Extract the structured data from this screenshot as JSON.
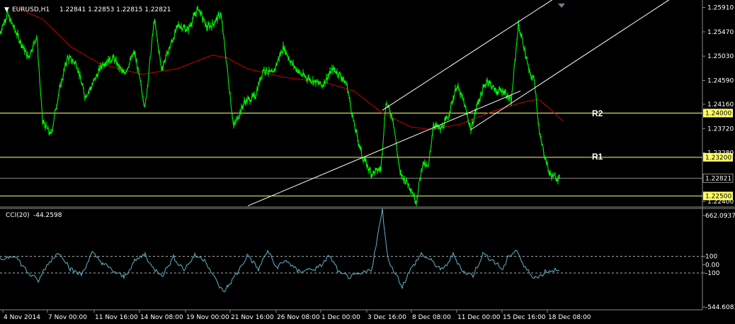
{
  "header": {
    "menu_glyph": "▼",
    "symbol": "EURUSD,H1",
    "ohlc": "1.22841 1.22853 1.22815 1.22821"
  },
  "indicator": {
    "name": "CCI(20)",
    "value": "-44.2598"
  },
  "price_axis": {
    "labels": [
      "1.25910",
      "1.25470",
      "1.25030",
      "1.24590",
      "1.24160",
      "1.23720",
      "1.23280",
      "1.22400"
    ]
  },
  "cci_axis": {
    "labels": [
      "662.0937",
      "100",
      "0.00",
      "-100",
      "-544.6083"
    ]
  },
  "lines": {
    "r2": {
      "label": "R2",
      "price": "1.24000",
      "color": "#ffff66"
    },
    "r1": {
      "label": "R1",
      "price": "1.23200",
      "color": "#ffff66"
    },
    "support": {
      "price": "1.22500",
      "color": "#ffff66"
    },
    "current": {
      "price": "1.22821",
      "color": "#8a8a8a"
    }
  },
  "time_axis": {
    "labels": [
      "4 Nov 2014",
      "7 Nov 00:00",
      "11 Nov 16:00",
      "14 Nov 08:00",
      "19 Nov 00:00",
      "21 Nov 16:00",
      "26 Nov 08:00",
      "1 Dec 00:00",
      "3 Dec 16:00",
      "8 Dec 08:00",
      "11 Dec 00:00",
      "15 Dec 16:00",
      "18 Dec 08:00"
    ]
  },
  "colors": {
    "background": "#000000",
    "price_series": "#00ff00",
    "moving_average": "#cc0000",
    "channel": "#ffffff",
    "cci": "#5fb4c8",
    "level_line": "#ffff66"
  },
  "chart_data": {
    "type": "line",
    "price_range": [
      1.223,
      1.2602
    ],
    "cci_range": [
      -544.6083,
      662.0937
    ],
    "cci_levels": [
      100,
      0,
      -100
    ],
    "price_anchors": [
      [
        0,
        1.2545
      ],
      [
        10,
        1.258
      ],
      [
        25,
        1.254
      ],
      [
        40,
        1.25
      ],
      [
        52,
        1.254
      ],
      [
        60,
        1.2385
      ],
      [
        72,
        1.236
      ],
      [
        82,
        1.243
      ],
      [
        95,
        1.25
      ],
      [
        108,
        1.249
      ],
      [
        120,
        1.243
      ],
      [
        130,
        1.245
      ],
      [
        145,
        1.249
      ],
      [
        160,
        1.25
      ],
      [
        175,
        1.247
      ],
      [
        190,
        1.251
      ],
      [
        205,
        1.241
      ],
      [
        218,
        1.257
      ],
      [
        228,
        1.248
      ],
      [
        240,
        1.252
      ],
      [
        252,
        1.256
      ],
      [
        265,
        1.255
      ],
      [
        280,
        1.259
      ],
      [
        292,
        1.2555
      ],
      [
        300,
        1.256
      ],
      [
        312,
        1.258
      ],
      [
        320,
        1.249
      ],
      [
        330,
        1.2375
      ],
      [
        345,
        1.242
      ],
      [
        360,
        1.243
      ],
      [
        372,
        1.248
      ],
      [
        385,
        1.247
      ],
      [
        400,
        1.252
      ],
      [
        412,
        1.249
      ],
      [
        425,
        1.247
      ],
      [
        440,
        1.246
      ],
      [
        455,
        1.245
      ],
      [
        470,
        1.248
      ],
      [
        480,
        1.247
      ],
      [
        490,
        1.245
      ],
      [
        500,
        1.238
      ],
      [
        512,
        1.232
      ],
      [
        525,
        1.229
      ],
      [
        538,
        1.23
      ],
      [
        545,
        1.242
      ],
      [
        555,
        1.239
      ],
      [
        565,
        1.229
      ],
      [
        578,
        1.227
      ],
      [
        588,
        1.224
      ],
      [
        597,
        1.231
      ],
      [
        605,
        1.23
      ],
      [
        612,
        1.238
      ],
      [
        622,
        1.237
      ],
      [
        632,
        1.239
      ],
      [
        645,
        1.245
      ],
      [
        655,
        1.242
      ],
      [
        665,
        1.237
      ],
      [
        675,
        1.242
      ],
      [
        688,
        1.246
      ],
      [
        700,
        1.244
      ],
      [
        712,
        1.244
      ],
      [
        722,
        1.242
      ],
      [
        732,
        1.256
      ],
      [
        740,
        1.252
      ],
      [
        748,
        1.247
      ],
      [
        755,
        1.246
      ],
      [
        762,
        1.236
      ],
      [
        770,
        1.232
      ],
      [
        776,
        1.229
      ],
      [
        782,
        1.2285
      ],
      [
        790,
        1.2282
      ]
    ],
    "ma_anchors": [
      [
        25,
        1.259
      ],
      [
        60,
        1.257
      ],
      [
        100,
        1.252
      ],
      [
        140,
        1.249
      ],
      [
        200,
        1.247
      ],
      [
        250,
        1.248
      ],
      [
        300,
        1.2505
      ],
      [
        320,
        1.25
      ],
      [
        350,
        1.248
      ],
      [
        400,
        1.2465
      ],
      [
        460,
        1.2455
      ],
      [
        500,
        1.244
      ],
      [
        540,
        1.24
      ],
      [
        580,
        1.2375
      ],
      [
        610,
        1.237
      ],
      [
        650,
        1.238
      ],
      [
        700,
        1.2405
      ],
      [
        740,
        1.242
      ],
      [
        760,
        1.2425
      ],
      [
        775,
        1.241
      ],
      [
        795,
        1.2385
      ]
    ],
    "cci_anchors": [
      [
        0,
        60
      ],
      [
        20,
        120
      ],
      [
        40,
        -100
      ],
      [
        55,
        -200
      ],
      [
        62,
        -60
      ],
      [
        75,
        90
      ],
      [
        85,
        150
      ],
      [
        100,
        -60
      ],
      [
        115,
        -120
      ],
      [
        130,
        140
      ],
      [
        145,
        20
      ],
      [
        160,
        -80
      ],
      [
        175,
        -150
      ],
      [
        190,
        40
      ],
      [
        205,
        130
      ],
      [
        215,
        -40
      ],
      [
        230,
        -120
      ],
      [
        245,
        90
      ],
      [
        260,
        -60
      ],
      [
        275,
        110
      ],
      [
        290,
        60
      ],
      [
        300,
        -120
      ],
      [
        315,
        -330
      ],
      [
        322,
        -260
      ],
      [
        335,
        -100
      ],
      [
        350,
        120
      ],
      [
        365,
        -60
      ],
      [
        378,
        170
      ],
      [
        390,
        -30
      ],
      [
        405,
        50
      ],
      [
        420,
        -80
      ],
      [
        435,
        -60
      ],
      [
        450,
        -40
      ],
      [
        465,
        110
      ],
      [
        480,
        -110
      ],
      [
        495,
        -150
      ],
      [
        512,
        -110
      ],
      [
        525,
        -50
      ],
      [
        540,
        662
      ],
      [
        548,
        60
      ],
      [
        560,
        -130
      ],
      [
        568,
        -260
      ],
      [
        580,
        -60
      ],
      [
        595,
        130
      ],
      [
        610,
        40
      ],
      [
        625,
        -70
      ],
      [
        640,
        120
      ],
      [
        655,
        -90
      ],
      [
        668,
        -130
      ],
      [
        682,
        130
      ],
      [
        695,
        60
      ],
      [
        710,
        -60
      ],
      [
        720,
        120
      ],
      [
        730,
        180
      ],
      [
        740,
        -30
      ],
      [
        752,
        -130
      ],
      [
        760,
        -160
      ],
      [
        770,
        -80
      ],
      [
        780,
        -70
      ],
      [
        790,
        -40
      ]
    ],
    "channel_lower": [
      [
        350,
        1.2232
      ],
      [
        735,
        1.244
      ]
    ],
    "channel_upper": [
      [
        540,
        1.2405
      ],
      [
        780,
        1.2605
      ]
    ],
    "channel_mid": [
      [
        665,
        1.237
      ],
      [
        945,
        1.2605
      ]
    ]
  }
}
